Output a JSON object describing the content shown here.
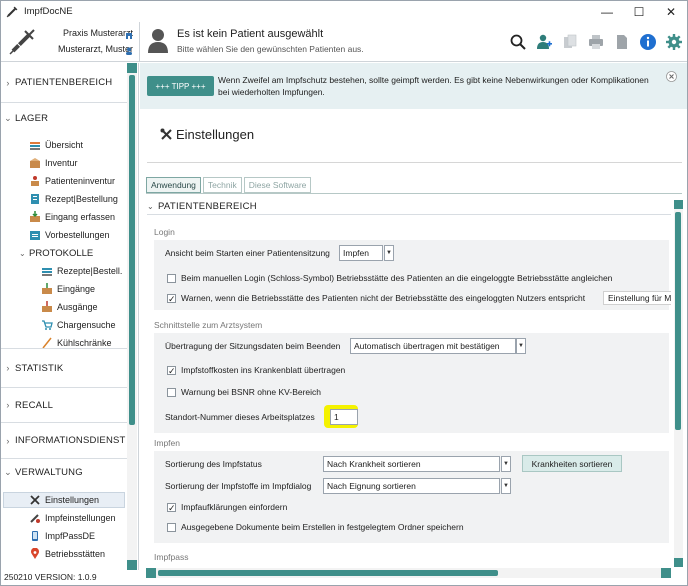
{
  "window": {
    "title": "ImpfDocNE",
    "minimize": "—",
    "maximize": "☐",
    "close": "✕"
  },
  "header": {
    "praxis": "Praxis Musterarzt",
    "user": "Musterarzt, Muster",
    "patient_title": "Es ist kein Patient ausgewählt",
    "patient_subtitle": "Bitte wählen Sie den gewünschten Patienten aus."
  },
  "tip": {
    "button": "+++ TIPP +++",
    "text": "Wenn Zweifel am Impfschutz bestehen, sollte geimpft werden. Es gibt keine Nebenwirkungen oder Komplikationen bei wiederholten Impfungen."
  },
  "sidebar": {
    "sections": {
      "patientenbereich": "PATIENTENBEREICH",
      "lager": "LAGER",
      "statistik": "STATISTIK",
      "recall": "RECALL",
      "informationsdienst": "INFORMATIONSDIENST",
      "verwaltung": "VERWALTUNG"
    },
    "lager_items": [
      "Übersicht",
      "Inventur",
      "Patienteninventur",
      "Rezept|Bestellung",
      "Eingang erfassen",
      "Vorbestellungen"
    ],
    "protokolle": "PROTOKOLLE",
    "protokolle_items": [
      "Rezepte|Bestell.",
      "Eingänge",
      "Ausgänge",
      "Chargensuche",
      "Kühlschränke"
    ],
    "verwaltung_items": [
      "Einstellungen",
      "Impfeinstellungen",
      "ImpfPassDE",
      "Betriebsstätten"
    ],
    "version": "250210 VERSION: 1.0.9"
  },
  "page": {
    "title": "Einstellungen",
    "tabs": [
      "Anwendung",
      "Technik",
      "Diese Software"
    ],
    "section": "PATIENTENBEREICH",
    "login": {
      "label": "Login",
      "start_label": "Ansicht beim Starten einer Patientensitzung",
      "start_value": "Impfen",
      "chk1": "Beim manuellen Login (Schloss-Symbol) Betriebsstätte des Patienten an die eingeloggte Betriebsstätte angleichen",
      "chk2": "Warnen, wenn die Betriebsstätte des Patienten nicht der Betriebsstätte des eingeloggten Nutzers entspricht",
      "chk2_extra": "Einstellung für M. Mus"
    },
    "schnittstelle": {
      "label": "Schnittstelle zum Arztsystem",
      "transfer_label": "Übertragung der Sitzungsdaten beim Beenden",
      "transfer_value": "Automatisch übertragen mit bestätigen",
      "chk1": "Impfstoffkosten ins Krankenblatt übertragen",
      "chk2": "Warnung bei BSNR ohne KV-Bereich",
      "standort_label": "Standort-Nummer dieses Arbeitsplatzes",
      "standort_value": "1"
    },
    "impfen": {
      "label": "Impfen",
      "sort_status_label": "Sortierung des Impfstatus",
      "sort_status_value": "Nach Krankheit sortieren",
      "sort_button": "Krankheiten sortieren",
      "sort_stoffe_label": "Sortierung der Impfstoffe im Impfdialog",
      "sort_stoffe_value": "Nach Eignung sortieren",
      "chk1": "Impfaufklärungen einfordern",
      "chk2": "Ausgegebene Dokumente beim Erstellen in festgelegtem Ordner speichern"
    },
    "impfpass": {
      "label": "Impfpass"
    }
  },
  "colors": {
    "accent": "#3f8f8a",
    "highlight": "#f4f200",
    "info": "#1f6fd0"
  }
}
